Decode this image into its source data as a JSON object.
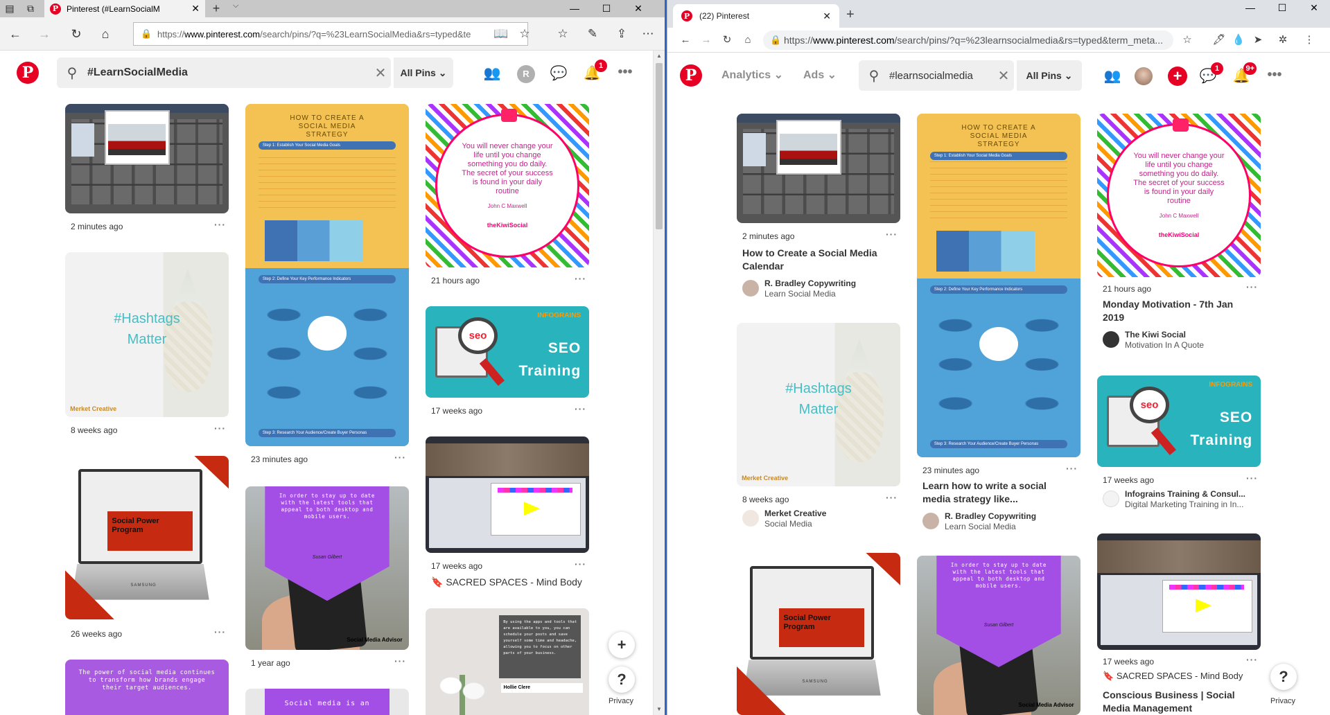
{
  "edge": {
    "tab_title": "Pinterest (#LearnSocialM",
    "url_prefix": "https://",
    "url_domain": "www.pinterest.com",
    "url_rest": "/search/pins/?q=%23LearnSocialMedia&rs=typed&te",
    "search_query": "#LearnSocialMedia",
    "all_pins_label": "All Pins",
    "notification_count": "1",
    "avatar_initial": "R",
    "pins": [
      {
        "time": "2 minutes ago"
      },
      {
        "time": "23 minutes ago"
      },
      {
        "time": "21 hours ago"
      },
      {
        "time": "8 weeks ago"
      },
      {
        "time": "17 weeks ago"
      },
      {
        "time": "17 weeks ago",
        "board": "SACRED SPACES - Mind Body"
      },
      {
        "time": "26 weeks ago"
      },
      {
        "time": "1 year ago"
      }
    ],
    "fab_plus": "+",
    "fab_help": "?",
    "privacy": "Privacy"
  },
  "chrome": {
    "tab_title": "(22) Pinterest",
    "url_prefix": "https://",
    "url_domain": "www.pinterest.com",
    "url_rest": "/search/pins/?q=%23learnsocialmedia&rs=typed&term_meta...",
    "nav_analytics": "Analytics",
    "nav_ads": "Ads",
    "search_query": "#learnsocialmedia",
    "all_pins_label": "All Pins",
    "messages_count": "1",
    "notification_count": "9+",
    "pins": [
      {
        "time": "2 minutes ago",
        "title1": "How to Create a Social Media",
        "title2": "Calendar",
        "creator": "R. Bradley Copywriting",
        "board": "Learn Social Media"
      },
      {
        "time": "23 minutes ago",
        "title1": "Learn how to write a social",
        "title2": "media strategy like...",
        "creator": "R. Bradley Copywriting",
        "board": "Learn Social Media"
      },
      {
        "time": "21 hours ago",
        "title1": "Monday Motivation - 7th Jan",
        "title2": "2019",
        "creator": "The Kiwi Social",
        "board": "Motivation In A Quote"
      },
      {
        "time": "8 weeks ago",
        "creator": "Merket Creative",
        "board": "Social Media"
      },
      {
        "time": "17 weeks ago",
        "creator": "Infograins Training & Consul...",
        "board": "Digital Marketing Training in In..."
      },
      {
        "time": "17 weeks ago",
        "board_line": "SACRED SPACES - Mind Body",
        "title1": "Conscious Business | Social",
        "title2": "Media Management"
      }
    ],
    "fab_help": "?",
    "privacy": "Privacy"
  },
  "art": {
    "strategy_title": "HOW TO CREATE A SOCIAL MEDIA STRATEGY",
    "strategy_step1": "Step 1: Establish Your Social Media Goals",
    "strategy_step2": "Step 2: Define Your Key Performance Indicators",
    "strategy_step3": "Step 3: Research Your Audience/Create Buyer Personas",
    "quote_text": "You will never change your life until you change something you do daily. The secret of your success is found in your daily routine",
    "quote_author": "John C Maxwell",
    "quote_brand": "theKiwiSocial",
    "hashtags_line1": "#Hashtags",
    "hashtags_line2": "Matter",
    "merket_logo": "Merket Creative",
    "seo_brand": "INFOGRAINS",
    "seo_badge": "seo",
    "seo_line1": "SEO",
    "seo_line2": "Training",
    "social_power": "Social Power Program",
    "samsung": "SAMSUNG",
    "purple_quote": "In order to stay up to date with the latest tools that appeal to both desktop and mobile users.",
    "purple_sig": "Susan Gilbert",
    "sma": "Social Media Advisor",
    "hollie_text": "By using the apps and tools that are available to you, you can schedule your posts and save yourself some time and headache, allowing you to focus on other parts of your business.",
    "hollie_name": "Hollie Clere",
    "power_text": "The power of social media continues to transform how brands engage their target audiences.",
    "social_is": "Social media is an"
  }
}
